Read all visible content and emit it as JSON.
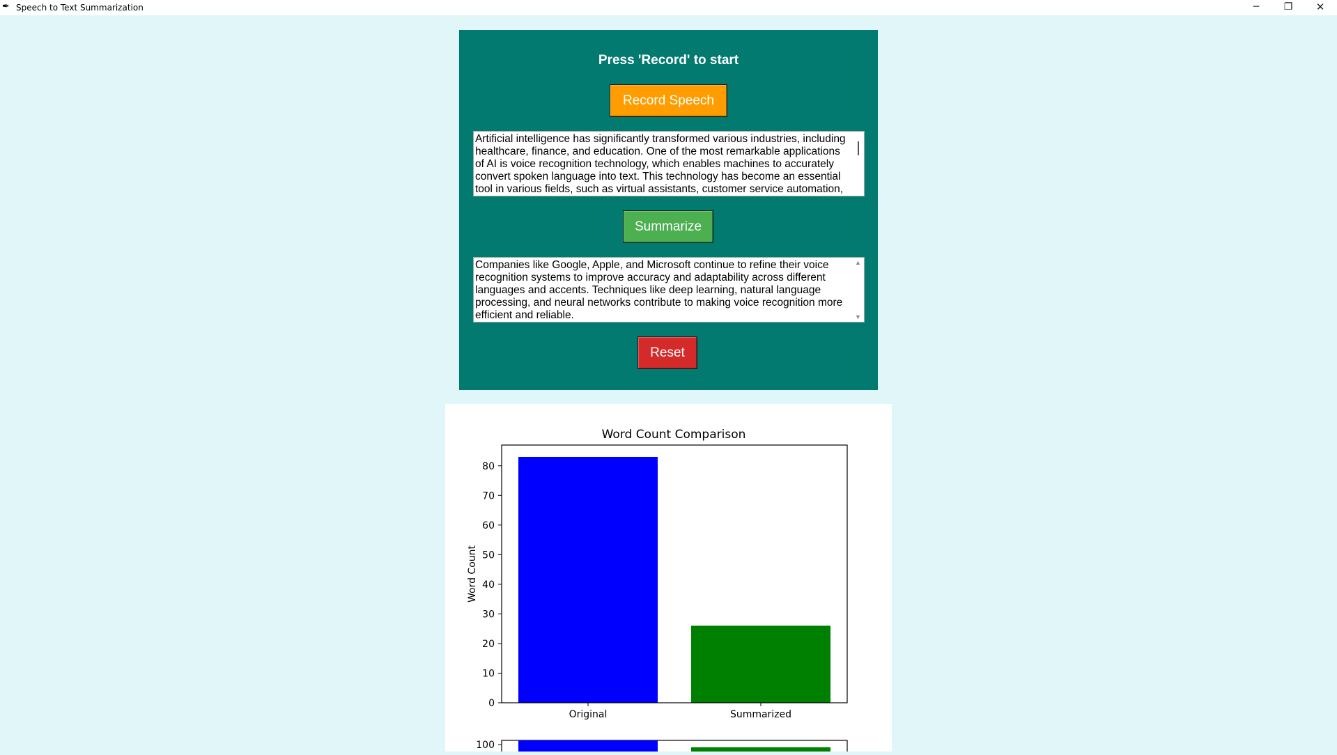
{
  "window": {
    "title": "Speech to Text Summarization",
    "minimize_glyph": "─",
    "maximize_glyph": "❐",
    "close_glyph": "✕",
    "app_icon": "feather-icon"
  },
  "controls": {
    "status_label": "Press 'Record' to start",
    "record_label": "Record Speech",
    "summarize_label": "Summarize",
    "reset_label": "Reset",
    "colors": {
      "panel": "#027a70",
      "record": "#ff9d00",
      "summarize": "#4caf50",
      "reset": "#d52a2a"
    }
  },
  "original_text": "Artificial intelligence has significantly transformed various industries, including healthcare, finance, and education. One of the most remarkable applications of AI is voice recognition technology, which enables machines to accurately convert spoken language into text. This technology has become an essential tool in various fields, such as virtual assistants, customer service automation,",
  "summary_text": "Companies like Google, Apple, and Microsoft continue to refine their voice recognition systems to improve accuracy and adaptability across different languages and accents. Techniques like deep learning, natural language processing, and neural networks contribute to making voice recognition more efficient and reliable.",
  "chart_data": [
    {
      "type": "bar",
      "title": "Word Count Comparison",
      "xlabel": "",
      "ylabel": "Word Count",
      "categories": [
        "Original",
        "Summarized"
      ],
      "values": [
        83,
        26
      ],
      "colors": [
        "#0000ff",
        "#008000"
      ],
      "ylim": [
        0,
        87
      ],
      "yticks": [
        0,
        10,
        20,
        30,
        40,
        50,
        60,
        70,
        80
      ],
      "grid": false
    },
    {
      "type": "bar",
      "partial": true,
      "visible_tick": "100"
    }
  ]
}
